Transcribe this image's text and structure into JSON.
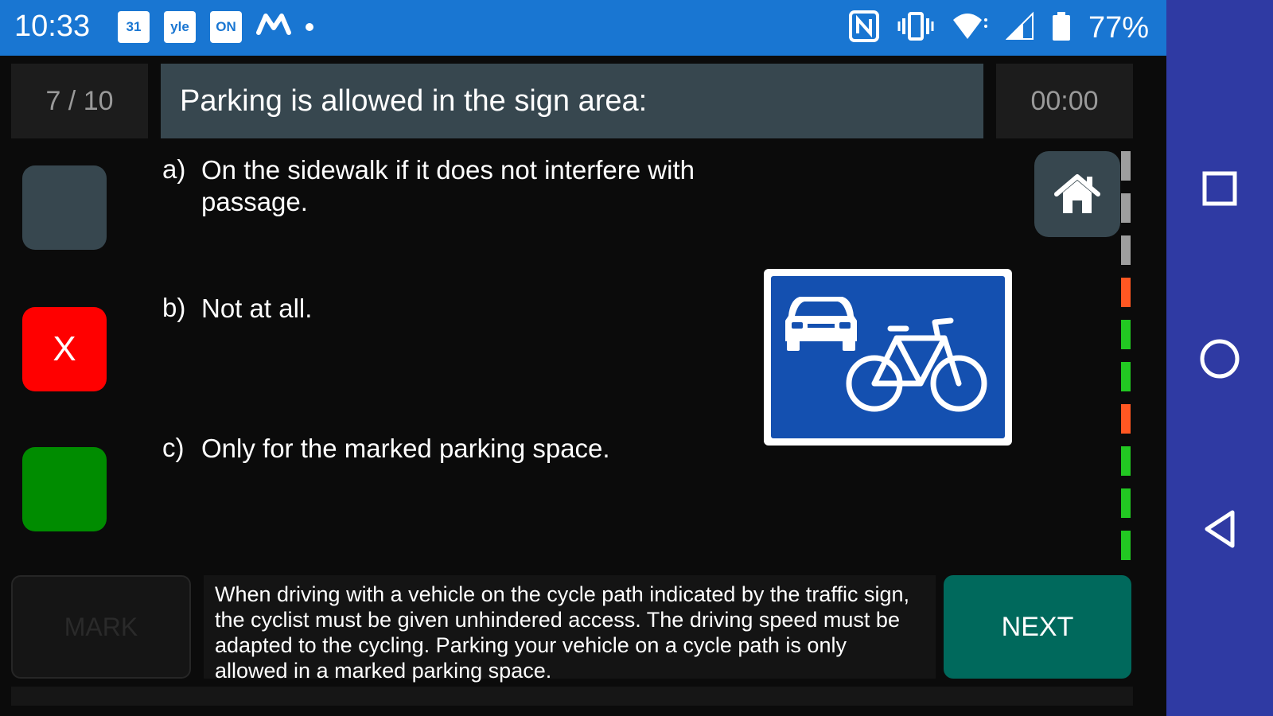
{
  "status_bar": {
    "time": "10:33",
    "notification_icons": [
      {
        "name": "calendar-icon",
        "text": "31"
      },
      {
        "name": "yle-icon",
        "text": "yle"
      },
      {
        "name": "news-app-icon",
        "text": "ON"
      }
    ],
    "system_icons": [
      "nfc-icon",
      "vibrate-icon",
      "wifi-icon",
      "signal-icon",
      "battery-icon"
    ],
    "battery_percent": "77%"
  },
  "quiz": {
    "counter": "7 / 10",
    "question": "Parking is allowed in the sign area:",
    "timer": "00:00",
    "answers": [
      {
        "letter": "a)",
        "text": "On the sidewalk if it does not interfere with passage.",
        "state": "neutral"
      },
      {
        "letter": "b)",
        "text": "Not at all.",
        "state": "wrong",
        "mark": "X"
      },
      {
        "letter": "c)",
        "text": "Only for the marked parking space.",
        "state": "correct"
      }
    ],
    "sign_image": "car-and-bicycle-sign-icon",
    "progress": [
      "gray",
      "gray",
      "gray",
      "orange",
      "green",
      "green",
      "orange",
      "green",
      "green",
      "green"
    ],
    "mark_label": "MARK",
    "explanation": "When driving with a vehicle on the cycle path indicated by the traffic sign, the cyclist must be given unhindered access. The driving speed must be adapted to the cycling. Parking your vehicle on a cycle path is only allowed in a marked parking space.",
    "next_label": "NEXT"
  },
  "colors": {
    "status_bar": "#1976d2",
    "nav_bar": "#2f3aa3",
    "question_bg": "#37474f",
    "neutral": "#37474f",
    "wrong": "#ff0000",
    "correct": "#008c00",
    "next": "#00695c",
    "progress_gray": "#9e9e9e",
    "progress_orange": "#ff5722",
    "progress_green": "#22c822",
    "sign_blue": "#1450b0"
  }
}
